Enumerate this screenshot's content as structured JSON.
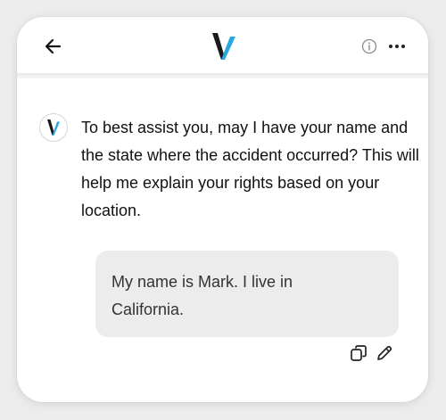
{
  "header": {
    "back_icon": "arrow-left-icon",
    "logo_icon": "v-logo-icon",
    "info_icon": "info-circle-icon",
    "more_icon": "more-horizontal-icon"
  },
  "colors": {
    "logo_dark": "#1a1a1a",
    "logo_accent": "#29a8e0",
    "bubble_bg": "#ececec"
  },
  "conversation": {
    "bot_message": "To best assist you, may I have your name and the state where the accident occurred? This will help me explain your rights based on your location.",
    "user_message": "My name is Mark. I live in California."
  },
  "message_actions": {
    "copy_icon": "copy-icon",
    "edit_icon": "pencil-icon"
  }
}
